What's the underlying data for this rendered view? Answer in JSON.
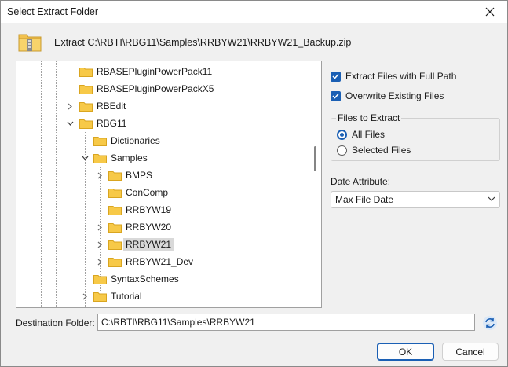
{
  "window": {
    "title": "Select Extract Folder"
  },
  "archive": {
    "label": "Extract C:\\RBTI\\RBG11\\Samples\\RRBYW21\\RRBYW21_Backup.zip"
  },
  "tree": {
    "items": [
      {
        "label": "RBASEPluginPowerPack11",
        "selected": false
      },
      {
        "label": "RBASEPluginPowerPackX5",
        "selected": false
      },
      {
        "label": "RBEdit",
        "selected": false
      },
      {
        "label": "RBG11",
        "selected": false
      },
      {
        "label": "Dictionaries",
        "selected": false
      },
      {
        "label": "Samples",
        "selected": false
      },
      {
        "label": "BMPS",
        "selected": false
      },
      {
        "label": "ConComp",
        "selected": false
      },
      {
        "label": "RRBYW19",
        "selected": false
      },
      {
        "label": "RRBYW20",
        "selected": false
      },
      {
        "label": "RRBYW21",
        "selected": true
      },
      {
        "label": "RRBYW21_Dev",
        "selected": false
      },
      {
        "label": "SyntaxSchemes",
        "selected": false
      },
      {
        "label": "Tutorial",
        "selected": false
      }
    ]
  },
  "options": {
    "full_path": {
      "label": "Extract Files with Full Path",
      "checked": true
    },
    "overwrite": {
      "label": "Overwrite Existing Files",
      "checked": true
    }
  },
  "files_to_extract": {
    "title": "Files to Extract",
    "all": {
      "label": "All Files",
      "selected": true
    },
    "selected": {
      "label": "Selected Files",
      "selected": false
    }
  },
  "date_attribute": {
    "label": "Date Attribute:",
    "value": "Max File Date"
  },
  "destination": {
    "label": "Destination Folder:",
    "value": "C:\\RBTI\\RBG11\\Samples\\RRBYW21"
  },
  "buttons": {
    "ok": "OK",
    "cancel": "Cancel"
  },
  "colors": {
    "accent": "#1a5fb4",
    "folder": "#f7c948",
    "selection": "#d9d9d9"
  },
  "icons": {
    "close": "close-icon",
    "archive": "zip-folder-icon",
    "folder": "folder-icon",
    "refresh": "refresh-icon"
  }
}
